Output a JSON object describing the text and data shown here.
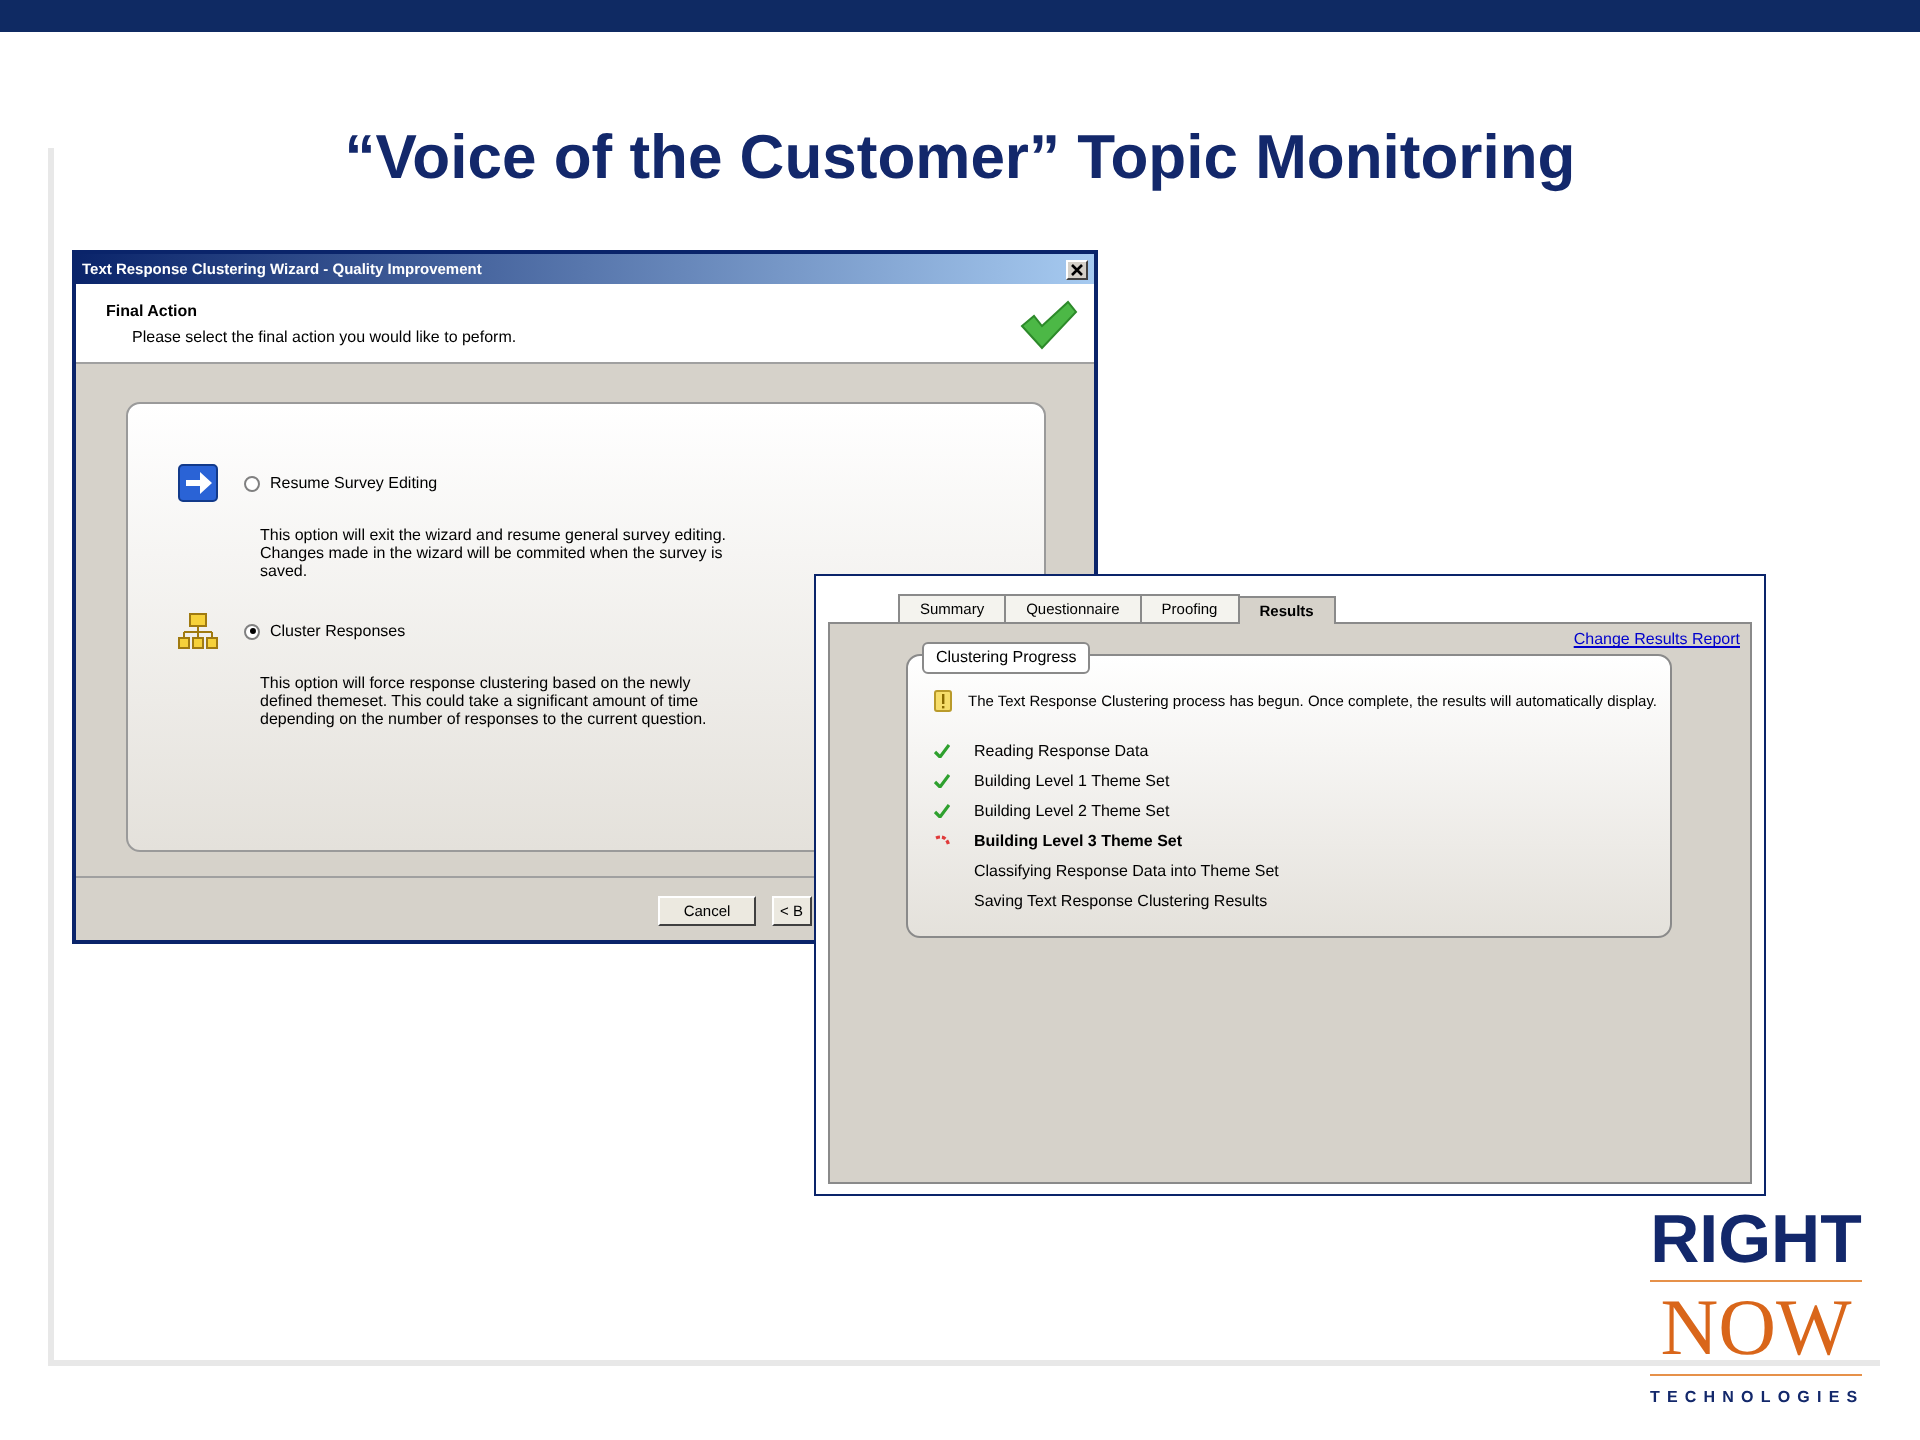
{
  "slide": {
    "title": "“Voice of the Customer” Topic Monitoring"
  },
  "wizard": {
    "title": "Text Response Clustering Wizard - Quality Improvement",
    "header_title": "Final Action",
    "header_subtitle": "Please select the final action you would like to peform.",
    "options": [
      {
        "kind": "arrow",
        "label": "Resume Survey Editing",
        "description": "This option will exit the wizard and resume general survey editing.  Changes made in the wizard will be commited when the survey is saved.",
        "selected": false
      },
      {
        "kind": "hierarchy",
        "label": "Cluster Responses",
        "description": "This option will force response clustering based on the newly defined themeset.  This could take a significant amount of time depending on the number of responses to the current question.",
        "selected": true
      }
    ],
    "buttons": [
      "Cancel",
      "< B"
    ]
  },
  "results": {
    "tabs": [
      {
        "label": "Summary",
        "selected": false
      },
      {
        "label": "Questionnaire",
        "selected": false
      },
      {
        "label": "Proofing",
        "selected": false
      },
      {
        "label": "Results",
        "selected": true
      }
    ],
    "link": "Change Results Report",
    "group_title": "Clustering Progress",
    "notice": "The Text Response Clustering process has begun.  Once complete, the results will automatically display.",
    "steps": [
      {
        "label": "Reading Response Data",
        "kind": "done"
      },
      {
        "label": "Building Level 1 Theme Set",
        "kind": "done"
      },
      {
        "label": "Building Level 2 Theme Set",
        "kind": "done"
      },
      {
        "label": "Building Level 3 Theme Set",
        "kind": "active"
      },
      {
        "label": "Classifying Response Data into Theme Set",
        "kind": "pending"
      },
      {
        "label": "Saving Text Response Clustering Results",
        "kind": "pending"
      }
    ]
  },
  "logo": {
    "line1": "RIGHT",
    "line2": "NOW",
    "line3": "TECHNOLOGIES"
  }
}
